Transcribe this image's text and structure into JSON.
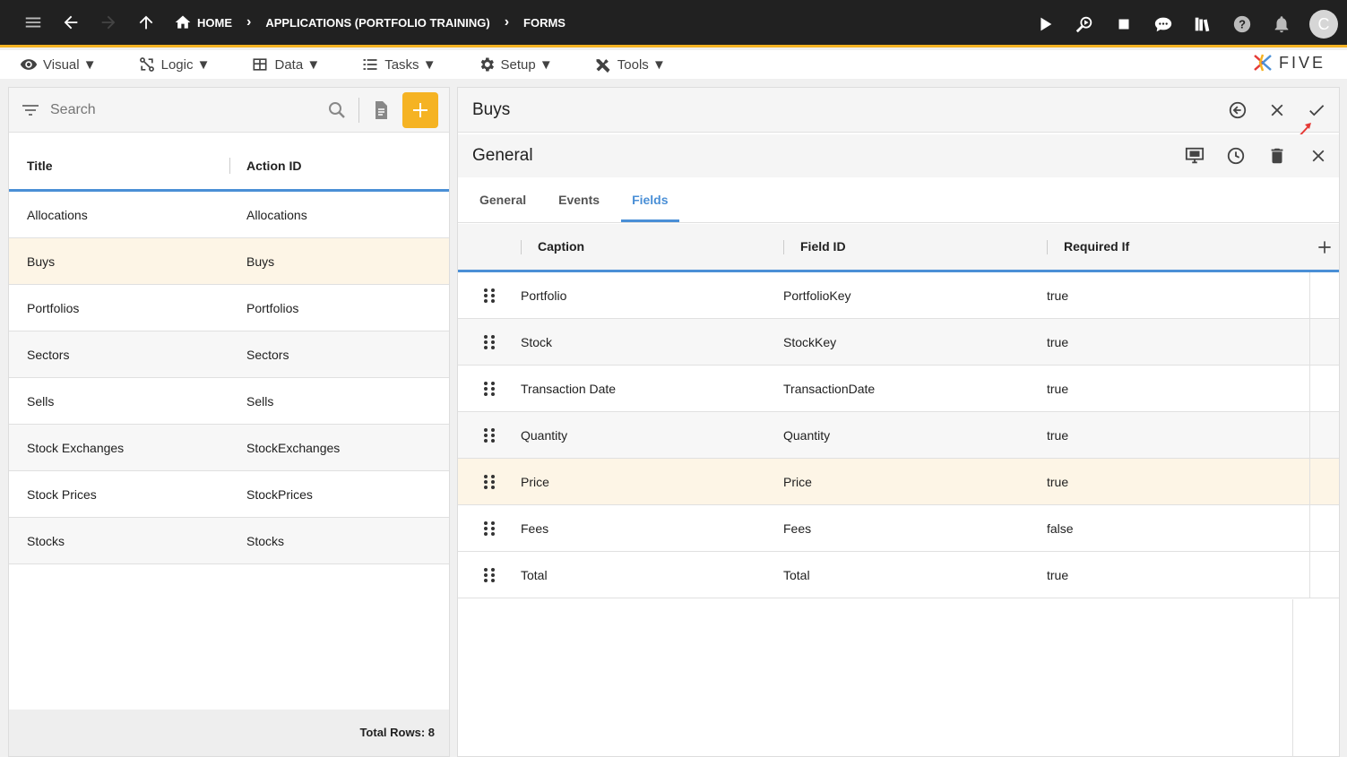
{
  "topbar": {
    "breadcrumbs": [
      "HOME",
      "APPLICATIONS (PORTFOLIO TRAINING)",
      "FORMS"
    ],
    "avatar_letter": "C"
  },
  "menubar": {
    "items": [
      "Visual ▼",
      "Logic ▼",
      "Data ▼",
      "Tasks ▼",
      "Setup ▼",
      "Tools ▼"
    ],
    "logo_text": "FIVE"
  },
  "left": {
    "search_placeholder": "Search",
    "columns": [
      "Title",
      "Action ID"
    ],
    "rows": [
      {
        "title": "Allocations",
        "action_id": "Allocations"
      },
      {
        "title": "Buys",
        "action_id": "Buys"
      },
      {
        "title": "Portfolios",
        "action_id": "Portfolios"
      },
      {
        "title": "Sectors",
        "action_id": "Sectors"
      },
      {
        "title": "Sells",
        "action_id": "Sells"
      },
      {
        "title": "Stock Exchanges",
        "action_id": "StockExchanges"
      },
      {
        "title": "Stock Prices",
        "action_id": "StockPrices"
      },
      {
        "title": "Stocks",
        "action_id": "Stocks"
      }
    ],
    "footer": "Total Rows: 8"
  },
  "right": {
    "title": "Buys",
    "subtitle": "General",
    "tabs": [
      "General",
      "Events",
      "Fields"
    ],
    "active_tab": "Fields",
    "columns": [
      "Caption",
      "Field ID",
      "Required If"
    ],
    "rows": [
      {
        "caption": "Portfolio",
        "field_id": "PortfolioKey",
        "required_if": "true"
      },
      {
        "caption": "Stock",
        "field_id": "StockKey",
        "required_if": "true"
      },
      {
        "caption": "Transaction Date",
        "field_id": "TransactionDate",
        "required_if": "true"
      },
      {
        "caption": "Quantity",
        "field_id": "Quantity",
        "required_if": "true"
      },
      {
        "caption": "Price",
        "field_id": "Price",
        "required_if": "true"
      },
      {
        "caption": "Fees",
        "field_id": "Fees",
        "required_if": "false"
      },
      {
        "caption": "Total",
        "field_id": "Total",
        "required_if": "true"
      }
    ]
  },
  "colors": {
    "accent": "#f5b323",
    "highlight": "#4a8fd6",
    "selected_row": "#fdf5e6"
  }
}
